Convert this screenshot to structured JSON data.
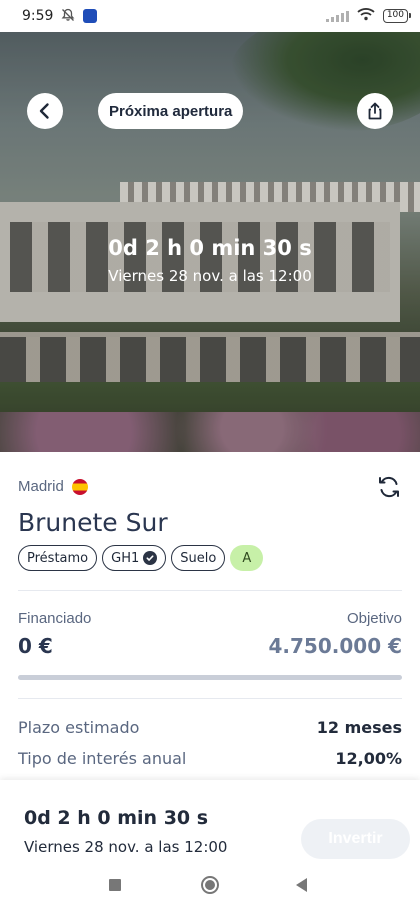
{
  "status_bar": {
    "time": "9:59",
    "battery": "100"
  },
  "hero": {
    "badge_label": "Próxima apertura",
    "countdown": "0d 2 h 0 min 30 s",
    "opening_date": "Viernes 28 nov. a las 12:00"
  },
  "project": {
    "location": "Madrid",
    "name": "Brunete Sur",
    "tags": [
      "Préstamo",
      "GH1",
      "Suelo",
      "A"
    ]
  },
  "funding": {
    "funded_label": "Financiado",
    "funded_value": "0 €",
    "target_label": "Objetivo",
    "target_value": "4.750.000 €",
    "progress_fraction": 0
  },
  "details": [
    {
      "label": "Plazo estimado",
      "value": "12 meses"
    },
    {
      "label": "Tipo de interés anual",
      "value": "12,00%"
    }
  ],
  "bottom_bar": {
    "countdown": "0d 2 h 0 min 30 s",
    "date": "Viernes 28 nov. a las 12:00",
    "invest_label": "Invertir"
  },
  "icons": {
    "back": "chevron-left-icon",
    "share": "share-icon",
    "refresh": "refresh-icon",
    "verified": "check-circle-icon",
    "flag": "spain-flag-icon"
  },
  "colors": {
    "primary_text": "#2a3650",
    "grade_badge": "#c7f0a8",
    "invest_disabled": "#eef1f5"
  }
}
